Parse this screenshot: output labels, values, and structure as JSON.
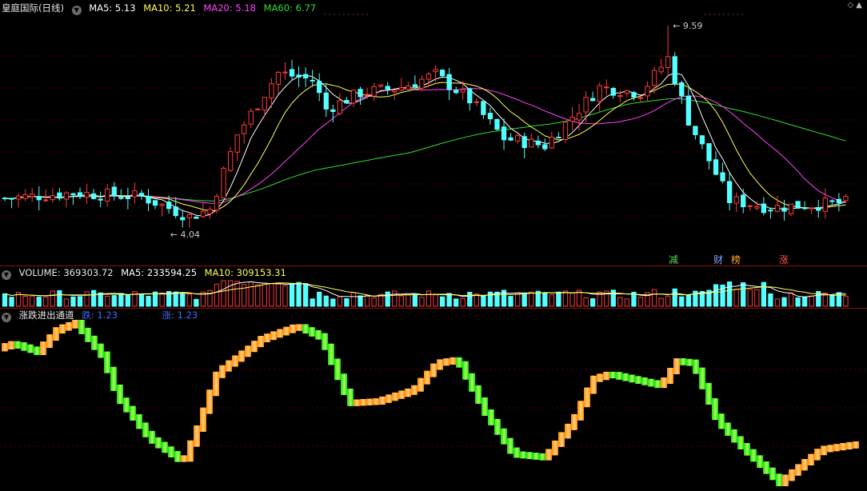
{
  "price_header": {
    "title": "皇庭国际(日线)",
    "ma5": "MA5: 5.13",
    "ma10": "MA10: 5.21",
    "ma20": "MA20: 5.18",
    "ma60": "MA60: 6.77"
  },
  "price_labels": {
    "high": "9.59",
    "low": "4.04"
  },
  "event_tags": [
    {
      "text": "减",
      "color": "#55dd55"
    },
    {
      "text": "财",
      "color": "#77aaff"
    },
    {
      "text": "榜",
      "color": "#ffaa33"
    },
    {
      "text": "涨",
      "color": "#ff5555"
    }
  ],
  "volume_header": {
    "volume": "VOLUME: 369303.72",
    "ma5": "MA5: 233594.25",
    "ma10": "MA10: 309153.31"
  },
  "indicator_header": {
    "title": "涨跌进出通道",
    "die": "跌: 1.23",
    "zhang": "涨: 1.23"
  },
  "colors": {
    "up": "#ff3b3b",
    "down": "#54ffff",
    "ma5": "#ffffff",
    "ma10": "#ffff55",
    "ma20": "#ff44ff",
    "ma60": "#33dd33",
    "grid": "#5a0000"
  },
  "icons": {
    "header_toggle": "chevron-down-icon",
    "corner": "diamond-icon"
  }
}
